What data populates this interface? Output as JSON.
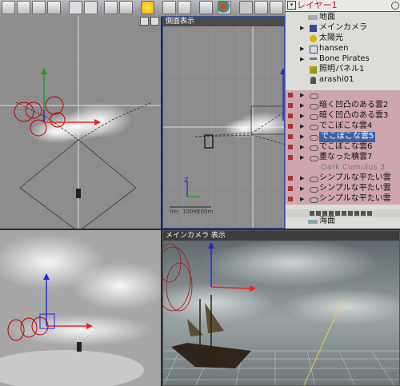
{
  "colors": {
    "accent": "#3d5fa3",
    "layer_title": "#b01824",
    "pink_rows": "#cfa6ae",
    "viewport_bg": "#8c8c8c"
  },
  "toolbar": {
    "icons": [
      "rotate-icon",
      "cube-icon",
      "cube-icon",
      "move-icon",
      "undo-icon",
      "play-icon",
      "camera-icon",
      "sun-icon",
      "cloud-icon",
      "palette-icon",
      "light-icon",
      "paint-icon",
      "globe-icon",
      "tool-icon",
      "tool-icon",
      "tool-icon",
      "tool-icon"
    ]
  },
  "viewports": {
    "top_left": {
      "title": ""
    },
    "side": {
      "title": "側面表示",
      "scale": {
        "v0": "0m",
        "v1": "100m",
        "v2": "200m"
      },
      "axis_z": "Z",
      "axis_y": "Y"
    },
    "bottom_left": {
      "title": ""
    },
    "camera": {
      "title": "メインカメラ 表示"
    }
  },
  "layer_panel": {
    "title": "レイヤー1",
    "items": [
      {
        "label": "地面",
        "icon": "ground-icon",
        "style": "normal"
      },
      {
        "label": "メインカメラ",
        "icon": "camera-icon",
        "style": "normal"
      },
      {
        "label": "太陽光",
        "icon": "sun-icon",
        "style": "normal"
      },
      {
        "label": "hansen",
        "icon": "object-icon",
        "style": "normal"
      },
      {
        "label": "Bone Pirates",
        "icon": "bone-icon",
        "style": "normal"
      },
      {
        "label": "照明パネル1",
        "icon": "light-panel-icon",
        "style": "normal"
      },
      {
        "label": "arashi01",
        "icon": "lamp-icon",
        "style": "normal"
      },
      {
        "label": "",
        "icon": "cloud-icon",
        "style": "pink"
      },
      {
        "label": "暗く凹凸のある雲2",
        "icon": "cloud-icon",
        "style": "pink"
      },
      {
        "label": "暗く凹凸のある雲3",
        "icon": "cloud-icon",
        "style": "pink"
      },
      {
        "label": "でこぼこな雲4",
        "icon": "cloud-icon",
        "style": "pink"
      },
      {
        "label": "でこぼこな雲5",
        "icon": "cloud-icon",
        "style": "selected"
      },
      {
        "label": "でこぼこな雲6",
        "icon": "cloud-icon",
        "style": "pink"
      },
      {
        "label": "重なった積雲7",
        "icon": "cloud-icon",
        "style": "pink"
      },
      {
        "label": "Dark Cumulus 3",
        "icon": "cloud-icon",
        "style": "dim"
      },
      {
        "label": "シンプルな平たい雲",
        "icon": "cloud-icon",
        "style": "pink"
      },
      {
        "label": "シンプルな平たい雲",
        "icon": "cloud-icon",
        "style": "pink"
      },
      {
        "label": "シンプルな平たい雲",
        "icon": "cloud-icon",
        "style": "pink"
      },
      {
        "label": "海面",
        "icon": "sea-icon",
        "style": "normal"
      }
    ]
  }
}
